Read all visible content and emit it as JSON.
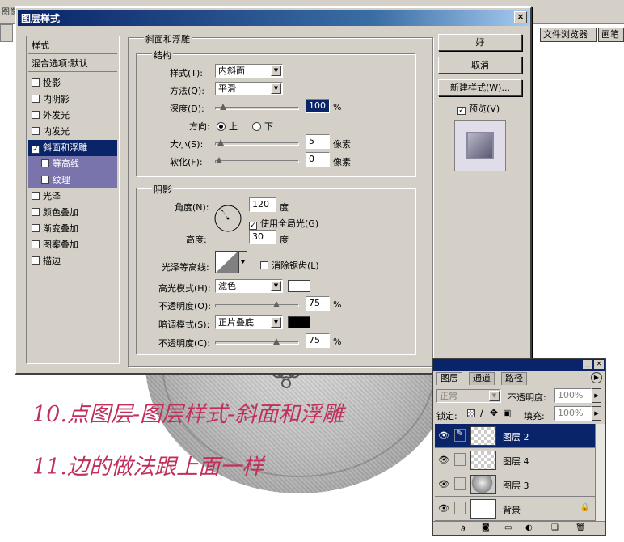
{
  "background": {
    "app_title_fragment": "图像",
    "file_browser_tab": "文件浏览器",
    "brushes_tab": "画笔"
  },
  "dialog": {
    "title": "图层样式",
    "close_label": "×",
    "styles_header": "样式",
    "blending_options": "混合选项:默认",
    "style_items": [
      {
        "label": "投影",
        "checked": false
      },
      {
        "label": "内阴影",
        "checked": false
      },
      {
        "label": "外发光",
        "checked": false
      },
      {
        "label": "内发光",
        "checked": false
      },
      {
        "label": "斜面和浮雕",
        "checked": true
      },
      {
        "label": "等高线",
        "checked": false
      },
      {
        "label": "纹理",
        "checked": false
      },
      {
        "label": "光泽",
        "checked": false
      },
      {
        "label": "颜色叠加",
        "checked": false
      },
      {
        "label": "渐变叠加",
        "checked": false
      },
      {
        "label": "图案叠加",
        "checked": false
      },
      {
        "label": "描边",
        "checked": false
      }
    ],
    "section_title": "斜面和浮雕",
    "structure": {
      "legend": "结构",
      "style_label": "样式(T):",
      "style_value": "内斜面",
      "technique_label": "方法(Q):",
      "technique_value": "平滑",
      "depth_label": "深度(D):",
      "depth_value": "100",
      "depth_unit": "%",
      "depth_slider": 0.05,
      "direction_label": "方向:",
      "direction_up": "上",
      "direction_down": "下",
      "direction_selected": "up",
      "size_label": "大小(S):",
      "size_value": "5",
      "size_unit": "像素",
      "size_slider": 0.02,
      "soften_label": "软化(F):",
      "soften_value": "0",
      "soften_unit": "像素",
      "soften_slider": 0.0
    },
    "shading": {
      "legend": "阴影",
      "angle_label": "角度(N):",
      "angle_value": "120",
      "angle_unit": "度",
      "global_light_label": "使用全局光(G)",
      "global_light_checked": true,
      "altitude_label": "高度:",
      "altitude_value": "30",
      "altitude_unit": "度",
      "gloss_contour_label": "光泽等高线:",
      "anti_alias_label": "消除锯齿(L)",
      "anti_alias_checked": false,
      "highlight_mode_label": "高光模式(H):",
      "highlight_mode_value": "滤色",
      "highlight_color": "#ffffff",
      "highlight_opacity_label": "不透明度(O):",
      "highlight_opacity_value": "75",
      "highlight_opacity_unit": "%",
      "highlight_opacity_slider": 0.75,
      "shadow_mode_label": "暗调模式(S):",
      "shadow_mode_value": "正片叠底",
      "shadow_color": "#000000",
      "shadow_opacity_label": "不透明度(C):",
      "shadow_opacity_value": "75",
      "shadow_opacity_unit": "%",
      "shadow_opacity_slider": 0.75
    },
    "buttons": {
      "ok": "好",
      "cancel": "取消",
      "new_style": "新建样式(W)...",
      "preview_label": "预览(V)",
      "preview_checked": true
    }
  },
  "annotations": {
    "line1": "10.点图层-图层样式-斜面和浮雕",
    "line2": "11.边的做法跟上面一样"
  },
  "layers_panel": {
    "tabs": [
      "图层",
      "通道",
      "路径"
    ],
    "blend_mode": "正常",
    "opacity_label": "不透明度:",
    "opacity_value": "100%",
    "lock_label": "锁定:",
    "fill_label": "填充:",
    "fill_value": "100%",
    "layers": [
      {
        "name": "图层 2",
        "active": true
      },
      {
        "name": "图层 4",
        "active": false
      },
      {
        "name": "图层 3",
        "active": false
      },
      {
        "name": "背景",
        "active": false
      }
    ]
  },
  "colors": {
    "titlebar": "#0a246a",
    "selected_item": "#0a246a",
    "sub_item": "#7a74ad",
    "annotation": "#c0305a"
  }
}
